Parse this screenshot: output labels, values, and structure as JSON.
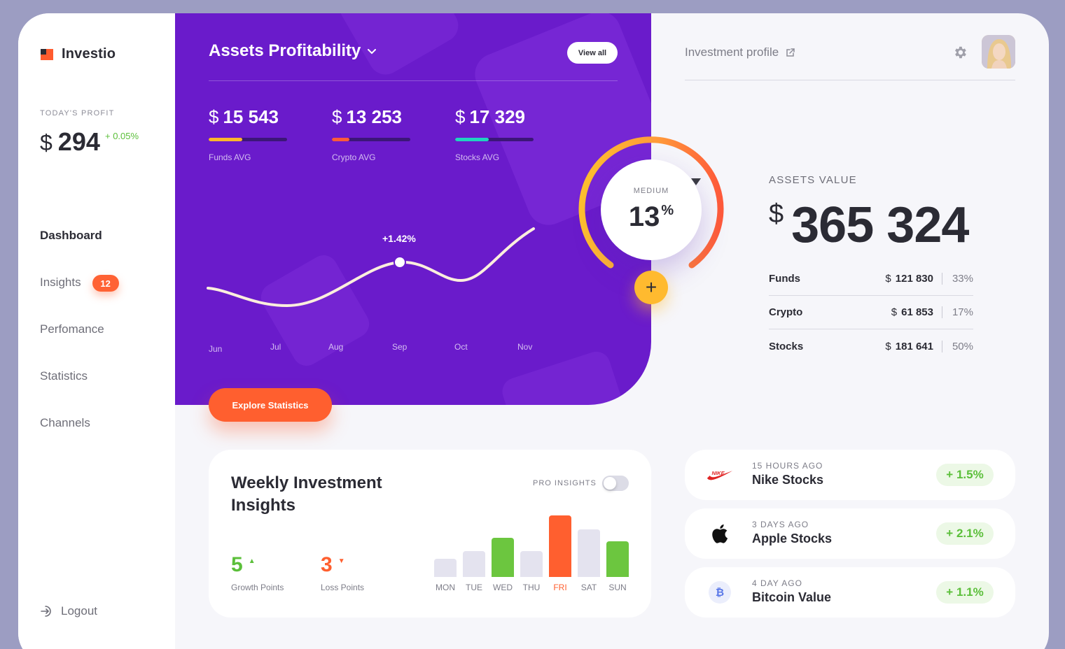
{
  "brand": {
    "name": "Investio"
  },
  "profit": {
    "label": "TODAY'S PROFIT",
    "currency": "$",
    "value": "294",
    "change": "+ 0.05%"
  },
  "nav": {
    "items": [
      {
        "label": "Dashboard",
        "active": true
      },
      {
        "label": "Insights",
        "badge": "12"
      },
      {
        "label": "Perfomance"
      },
      {
        "label": "Statistics"
      },
      {
        "label": "Channels"
      }
    ],
    "logout": "Logout"
  },
  "profitability": {
    "title": "Assets Profitability",
    "view_all": "View all",
    "metrics": [
      {
        "currency": "$",
        "value": "15 543",
        "label": "Funds AVG",
        "color": "#ffb72b",
        "fill": 0.43
      },
      {
        "currency": "$",
        "value": "13 253",
        "label": "Crypto AVG",
        "color": "#ff5a3a",
        "fill": 0.22
      },
      {
        "currency": "$",
        "value": "17 329",
        "label": "Stocks AVG",
        "color": "#21d1c0",
        "fill": 0.43
      }
    ],
    "months": [
      "Jun",
      "Jul",
      "Aug",
      "Sep",
      "Oct",
      "Nov"
    ],
    "highlight": "+1.42%",
    "explore": "Explore Statistics"
  },
  "gauge": {
    "label": "MEDIUM",
    "value": "13",
    "unit": "%",
    "plus": "+"
  },
  "header": {
    "investment_profile": "Investment profile"
  },
  "assets": {
    "label": "ASSETS VALUE",
    "currency": "$",
    "value": "365 324",
    "rows": [
      {
        "name": "Funds",
        "currency": "$",
        "amount": "121 830",
        "pct": "33%"
      },
      {
        "name": "Crypto",
        "currency": "$",
        "amount": "61 853",
        "pct": "17%"
      },
      {
        "name": "Stocks",
        "currency": "$",
        "amount": "181 641",
        "pct": "50%"
      }
    ]
  },
  "weekly": {
    "title": "Weekly Investment Insights",
    "pro_label": "PRO INSIGHTS",
    "growth": {
      "value": "5",
      "label": "Growth Points",
      "color": "#5bbf3a"
    },
    "loss": {
      "value": "3",
      "label": "Loss Points",
      "color": "#ff5f2f"
    },
    "chart_data": {
      "type": "bar",
      "categories": [
        "MON",
        "TUE",
        "WED",
        "THU",
        "FRI",
        "SAT",
        "SUN"
      ],
      "values": [
        26,
        37,
        56,
        37,
        88,
        68,
        51
      ],
      "colors": [
        "#e4e3ef",
        "#e4e3ef",
        "#6cc63f",
        "#e4e3ef",
        "#ff5f2f",
        "#e4e3ef",
        "#6cc63f"
      ],
      "highlight_day": "FRI"
    }
  },
  "stocks": [
    {
      "ago": "15 HOURS AGO",
      "name": "Nike Stocks",
      "change": "+ 1.5%",
      "icon": "nike-icon"
    },
    {
      "ago": "3 DAYS AGO",
      "name": "Apple Stocks",
      "change": "+ 2.1%",
      "icon": "apple-icon"
    },
    {
      "ago": "4 DAY AGO",
      "name": "Bitcoin Value",
      "change": "+ 1.1%",
      "icon": "bitcoin-icon"
    }
  ]
}
